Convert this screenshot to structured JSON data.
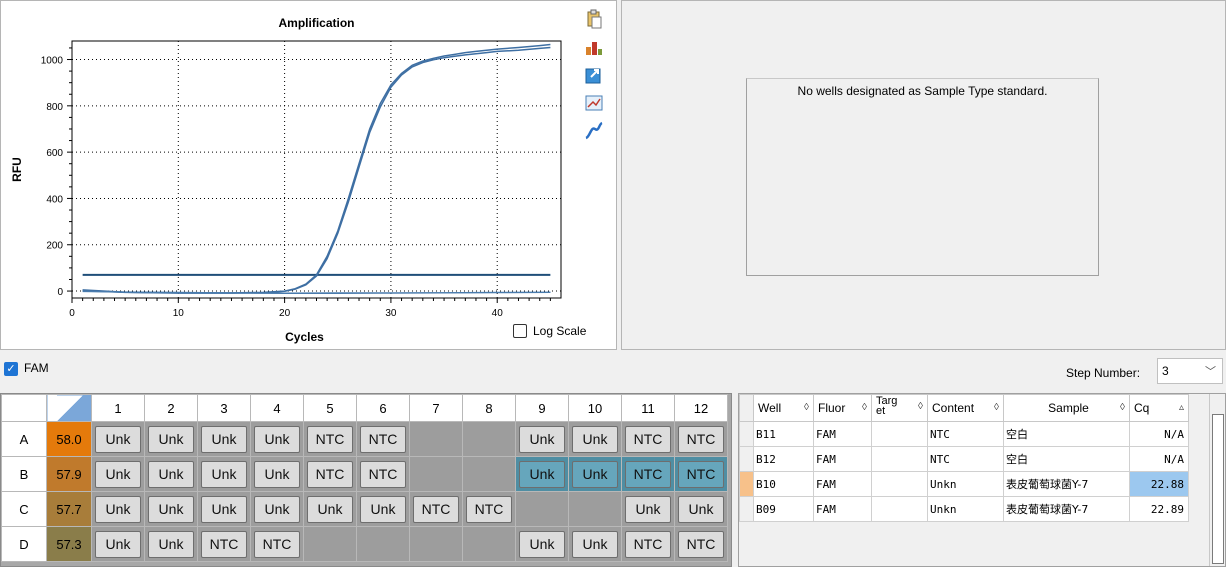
{
  "chart_data": {
    "type": "line",
    "title": "Amplification",
    "xlabel": "Cycles",
    "ylabel": "RFU",
    "xlim": [
      0,
      46
    ],
    "ylim": [
      -30,
      1080
    ],
    "xticks": [
      0,
      10,
      20,
      30,
      40
    ],
    "yticks": [
      0,
      200,
      400,
      600,
      800,
      1000
    ],
    "grid": true,
    "threshold": 70,
    "series": [
      {
        "x": [
          1,
          5,
          10,
          15,
          18,
          20,
          21,
          22,
          23,
          24,
          25,
          26,
          27,
          28,
          29,
          30,
          31,
          32,
          33,
          34,
          35,
          36,
          37,
          38,
          39,
          40,
          42,
          44,
          45
        ],
        "values": [
          5,
          -5,
          -8,
          -8,
          -6,
          0,
          10,
          30,
          70,
          150,
          260,
          400,
          550,
          700,
          810,
          890,
          940,
          975,
          993,
          1005,
          1015,
          1022,
          1030,
          1035,
          1040,
          1045,
          1052,
          1060,
          1065
        ]
      },
      {
        "x": [
          1,
          5,
          10,
          15,
          18,
          20,
          21,
          22,
          23,
          24,
          25,
          26,
          27,
          28,
          29,
          30,
          31,
          32,
          33,
          34,
          35,
          36,
          37,
          38,
          39,
          40,
          42,
          44,
          45
        ],
        "values": [
          3,
          -6,
          -9,
          -9,
          -7,
          -1,
          8,
          27,
          65,
          140,
          250,
          385,
          535,
          685,
          795,
          880,
          933,
          968,
          987,
          999,
          1008,
          1014,
          1020,
          1025,
          1030,
          1035,
          1040,
          1048,
          1052
        ]
      },
      {
        "x": [
          1,
          5,
          10,
          15,
          20,
          25,
          30,
          35,
          40,
          45
        ],
        "values": [
          -2,
          -4,
          -6,
          -8,
          -10,
          -10,
          -9,
          -8,
          -7,
          -6
        ]
      },
      {
        "x": [
          1,
          5,
          10,
          15,
          20,
          25,
          30,
          35,
          40,
          45
        ],
        "values": [
          0,
          -6,
          -8,
          -9,
          -9,
          -8,
          -8,
          -7,
          -6,
          -5
        ]
      }
    ]
  },
  "chart_panel": {
    "log_scale_label": "Log Scale",
    "icons": [
      "clipboard-icon",
      "chart-settings-icon",
      "export-icon",
      "zoom-icon",
      "curve-icon"
    ]
  },
  "standard_panel": {
    "message": "No wells designated as Sample Type standard."
  },
  "fluor_bar": {
    "fam_label": "FAM",
    "step_label": "Step Number:",
    "step_value": "3"
  },
  "plate": {
    "columns": [
      "1",
      "2",
      "3",
      "4",
      "5",
      "6",
      "7",
      "8",
      "9",
      "10",
      "11",
      "12"
    ],
    "rows": [
      {
        "label": "A",
        "temp": "58.0",
        "temp_color": "#e47a0b",
        "wells": [
          "Unk",
          "Unk",
          "Unk",
          "Unk",
          "NTC",
          "NTC",
          "",
          "",
          "Unk",
          "Unk",
          "NTC",
          "NTC"
        ],
        "selected": []
      },
      {
        "label": "B",
        "temp": "57.9",
        "temp_color": "#c07a2c",
        "wells": [
          "Unk",
          "Unk",
          "Unk",
          "Unk",
          "NTC",
          "NTC",
          "",
          "",
          "Unk",
          "Unk",
          "NTC",
          "NTC"
        ],
        "selected": [
          8,
          9,
          10,
          11
        ]
      },
      {
        "label": "C",
        "temp": "57.7",
        "temp_color": "#a87d3a",
        "wells": [
          "Unk",
          "Unk",
          "Unk",
          "Unk",
          "Unk",
          "Unk",
          "NTC",
          "NTC",
          "",
          "",
          "Unk",
          "Unk"
        ],
        "selected": []
      },
      {
        "label": "D",
        "temp": "57.3",
        "temp_color": "#8a7d4a",
        "wells": [
          "Unk",
          "Unk",
          "NTC",
          "NTC",
          "",
          "",
          "",
          "",
          "Unk",
          "Unk",
          "NTC",
          "NTC"
        ],
        "selected": []
      }
    ]
  },
  "results": {
    "headers": [
      "Well",
      "Fluor",
      "Target",
      "Content",
      "Sample",
      "Cq"
    ],
    "rows": [
      {
        "well": "B11",
        "fluor": "FAM",
        "target": "",
        "content": "NTC",
        "sample": "空白",
        "cq": "N/A",
        "active": false
      },
      {
        "well": "B12",
        "fluor": "FAM",
        "target": "",
        "content": "NTC",
        "sample": "空白",
        "cq": "N/A",
        "active": false
      },
      {
        "well": "B10",
        "fluor": "FAM",
        "target": "",
        "content": "Unkn",
        "sample": "表皮葡萄球菌Y-7",
        "cq": "22.88",
        "active": true
      },
      {
        "well": "B09",
        "fluor": "FAM",
        "target": "",
        "content": "Unkn",
        "sample": "表皮葡萄球菌Y-7",
        "cq": "22.89",
        "active": false
      }
    ]
  }
}
